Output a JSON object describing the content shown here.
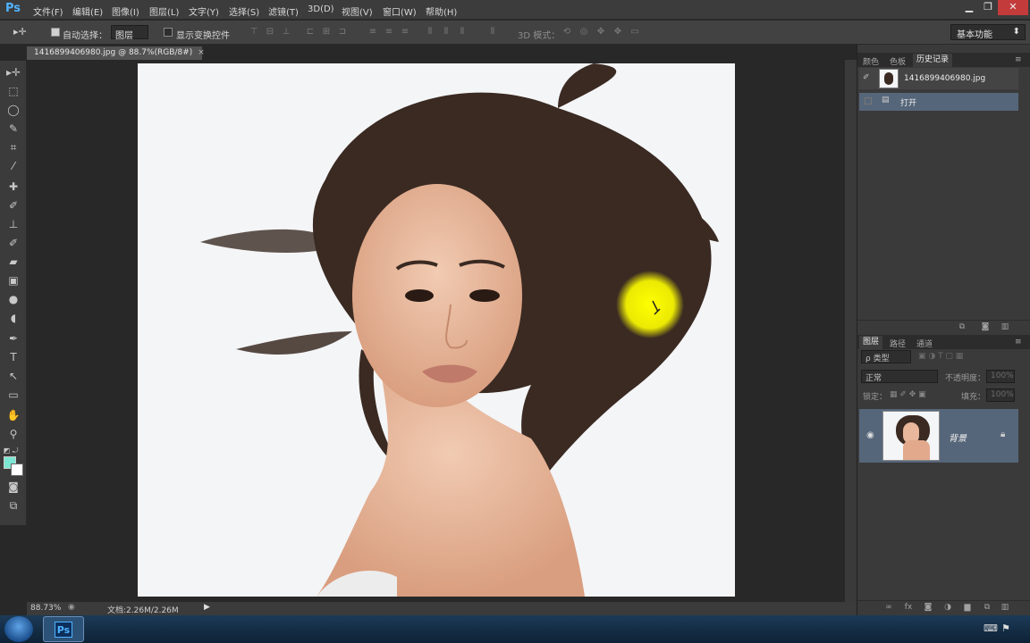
{
  "app": {
    "logo_text": "Ps"
  },
  "menu": [
    "文件(F)",
    "编辑(E)",
    "图像(I)",
    "图层(L)",
    "文字(Y)",
    "选择(S)",
    "滤镜(T)",
    "3D(D)",
    "视图(V)",
    "窗口(W)",
    "帮助(H)"
  ],
  "window_controls": {
    "minimize": "▁",
    "maximize": "❐",
    "close": "✕"
  },
  "options": {
    "auto_select_label": "自动选择：",
    "auto_select_value": "图层",
    "show_transform_label": "显示变换控件",
    "mode_3d_label": "3D 模式：",
    "workspace": "基本功能"
  },
  "document": {
    "tab_title": "1416899406980.jpg @ 88.7%(RGB/8#)",
    "tab_close": "×",
    "zoom": "88.73%",
    "doc_size": "文档:2.26M/2.26M"
  },
  "panels": {
    "top_tabs": [
      "颜色",
      "色板",
      "历史记录"
    ],
    "history": {
      "snapshot_name": "1416899406980.jpg",
      "items": [
        "打开"
      ]
    },
    "layers_tabs": [
      "图层",
      "路径",
      "通道"
    ],
    "layers": {
      "filter_label": "ρ 类型",
      "blend_mode": "正常",
      "opacity_label": "不透明度：",
      "opacity_value": "100%",
      "lock_label": "锁定：",
      "fill_label": "填充：",
      "fill_value": "100%",
      "items": [
        {
          "name": "背景",
          "visible": true,
          "locked": true
        }
      ]
    }
  },
  "colors": {
    "foreground": "#7de6d2",
    "background": "#ffffff",
    "accent": "#4fb3ff",
    "selected_row": "#56667a"
  }
}
